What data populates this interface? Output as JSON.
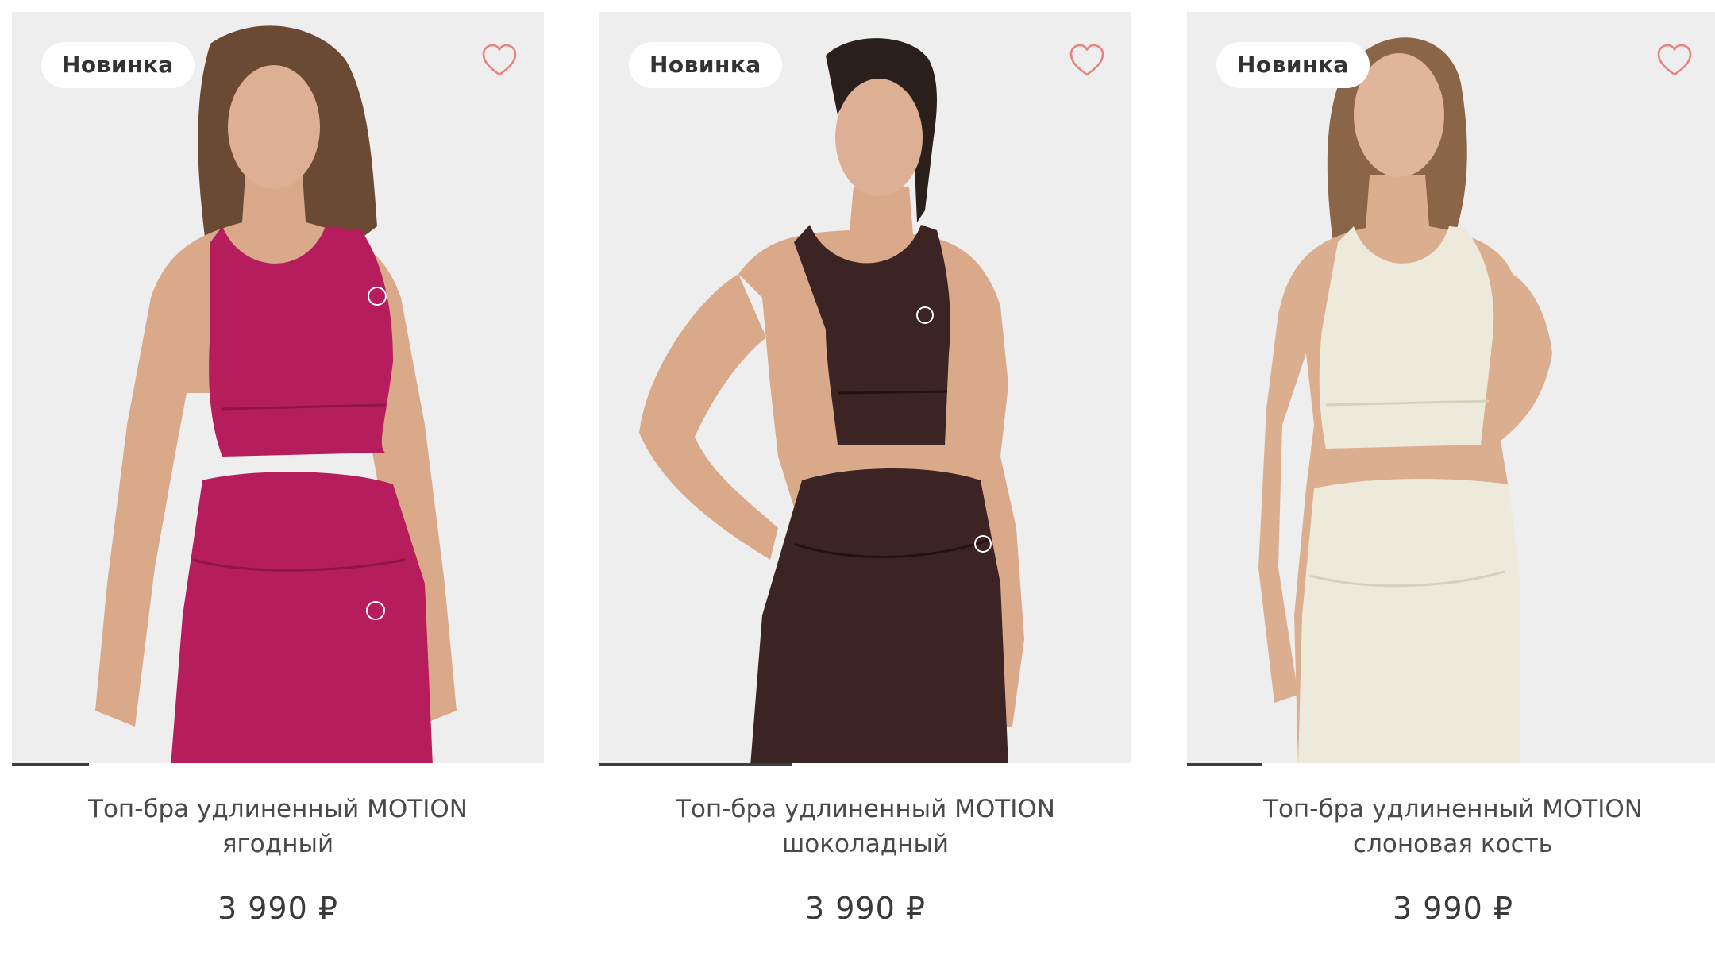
{
  "products": [
    {
      "badge": "Новинка",
      "name_line1": "Топ-бра удлиненный MOTION",
      "name_line2": "ягодный",
      "price": "3 990 ₽",
      "garment_color": "#b51d5c",
      "slider_progress": 0.15
    },
    {
      "badge": "Новинка",
      "name_line1": "Топ-бра удлиненный MOTION",
      "name_line2": "шоколадный",
      "price": "3 990 ₽",
      "garment_color": "#3b2423",
      "slider_progress": 0.365
    },
    {
      "badge": "Новинка",
      "name_line1": "Топ-бра удлиненный MOTION",
      "name_line2": "слоновая кость",
      "price": "3 990 ₽",
      "garment_color": "#eeeadb",
      "slider_progress": 0.145
    }
  ],
  "colors": {
    "photo_background": "#efeeef",
    "skin": "#d9a98a",
    "hair": "#6b4a33",
    "heart": "#e6837d",
    "progress": "#3b3d44"
  },
  "icons": {
    "favorite": "heart-outline-icon",
    "brand": "tree-logo-icon"
  }
}
